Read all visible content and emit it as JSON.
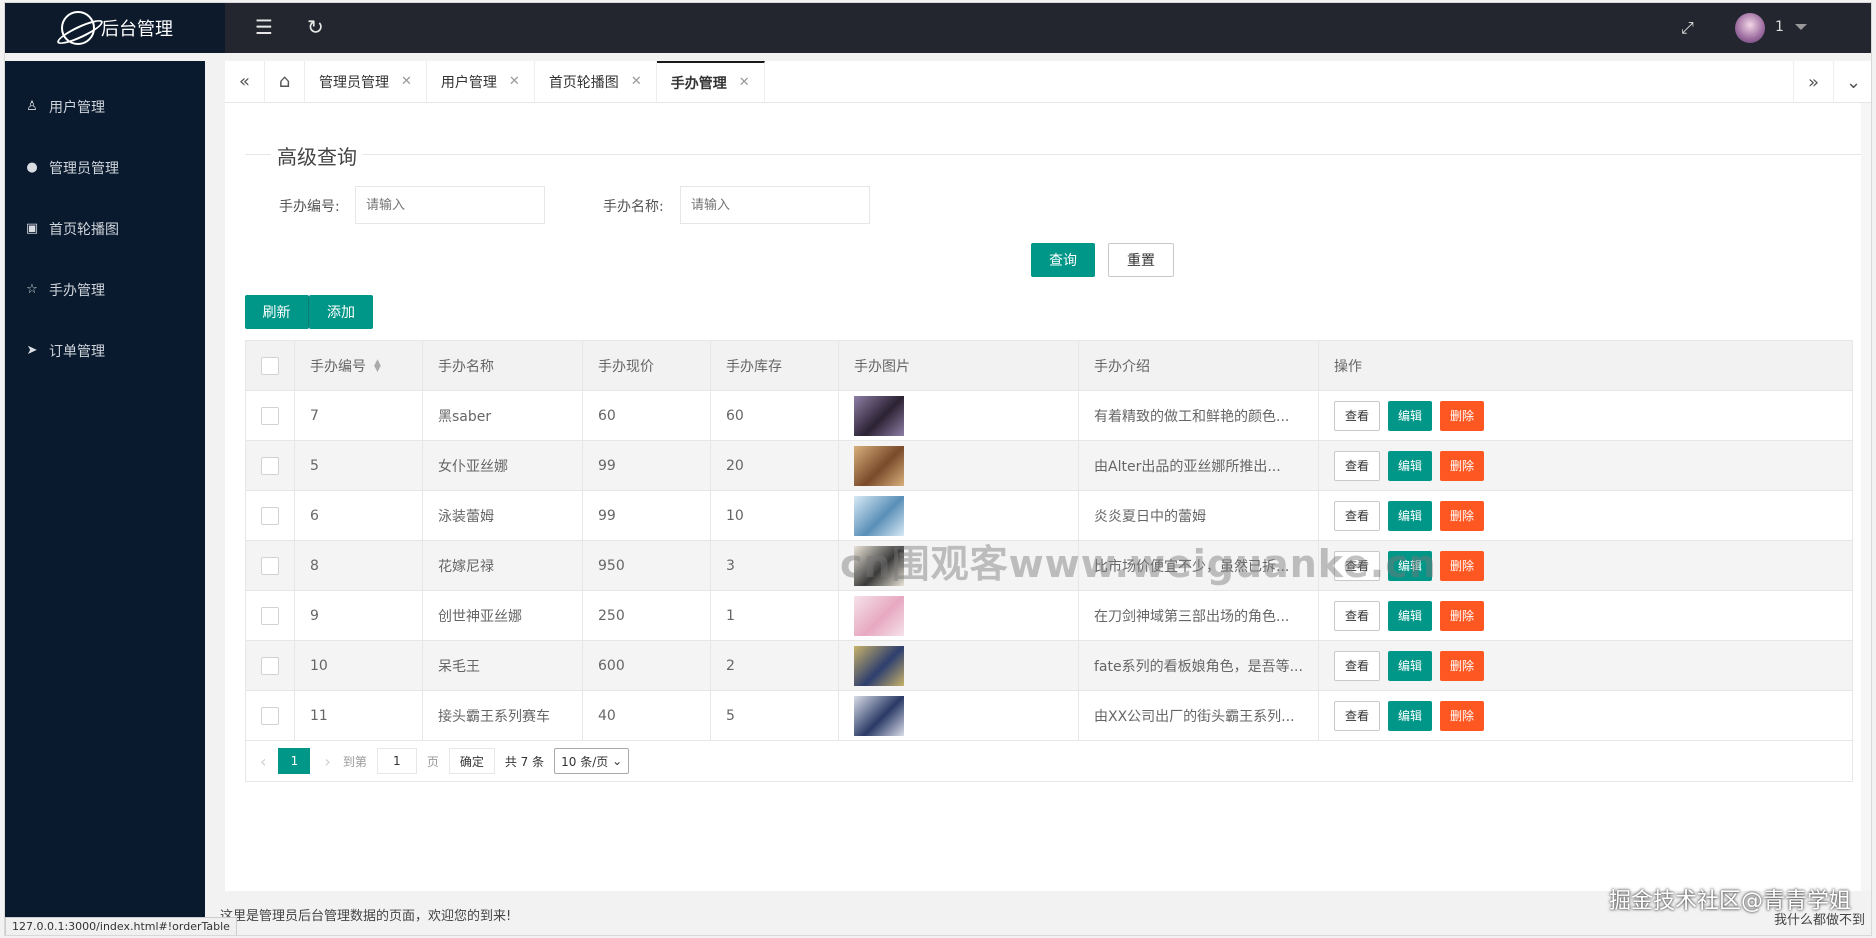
{
  "app": {
    "title": "后台管理"
  },
  "header": {
    "user_name": "1"
  },
  "sidebar": {
    "items": [
      {
        "label": "用户管理",
        "icon": "user-icon"
      },
      {
        "label": "管理员管理",
        "icon": "admin-icon"
      },
      {
        "label": "首页轮播图",
        "icon": "image-icon"
      },
      {
        "label": "手办管理",
        "icon": "star-icon"
      },
      {
        "label": "订单管理",
        "icon": "send-icon"
      }
    ]
  },
  "tabs": [
    {
      "label": "管理员管理"
    },
    {
      "label": "用户管理"
    },
    {
      "label": "首页轮播图"
    },
    {
      "label": "手办管理",
      "active": true
    }
  ],
  "search": {
    "title": "高级查询",
    "field1_label": "手办编号:",
    "field1_placeholder": "请输入",
    "field2_label": "手办名称:",
    "field2_placeholder": "请输入",
    "query_label": "查询",
    "reset_label": "重置"
  },
  "toolbar": {
    "refresh_label": "刷新",
    "add_label": "添加"
  },
  "table": {
    "columns": [
      "手办编号",
      "手办名称",
      "手办现价",
      "手办库存",
      "手办图片",
      "手办介绍",
      "操作"
    ],
    "rows": [
      {
        "id": "7",
        "name": "黑saber",
        "price": "60",
        "stock": "60",
        "intro": "有着精致的做工和鲜艳的颜色..."
      },
      {
        "id": "5",
        "name": "女仆亚丝娜",
        "price": "99",
        "stock": "20",
        "intro": "由Alter出品的亚丝娜所推出..."
      },
      {
        "id": "6",
        "name": "泳装蕾姆",
        "price": "99",
        "stock": "10",
        "intro": "炎炎夏日中的蕾姆"
      },
      {
        "id": "8",
        "name": "花嫁尼禄",
        "price": "950",
        "stock": "3",
        "intro": "比市场价便宜不少，虽然已拆..."
      },
      {
        "id": "9",
        "name": "创世神亚丝娜",
        "price": "250",
        "stock": "1",
        "intro": "在刀剑神域第三部出场的角色..."
      },
      {
        "id": "10",
        "name": "呆毛王",
        "price": "600",
        "stock": "2",
        "intro": "fate系列的看板娘角色，是吾等..."
      },
      {
        "id": "11",
        "name": "接头霸王系列赛车",
        "price": "40",
        "stock": "5",
        "intro": "由XX公司出厂的街头霸王系列..."
      }
    ],
    "actions": {
      "view": "查看",
      "edit": "编辑",
      "delete": "删除"
    }
  },
  "pager": {
    "current": "1",
    "goto_label": "到第",
    "page_value": "1",
    "page_unit": "页",
    "confirm_label": "确定",
    "total_label": "共 7 条",
    "page_size": "10 条/页"
  },
  "footer": {
    "text": "这里是管理员后台管理数据的页面，欢迎您的到来!",
    "right_text": "我什么都做不到"
  },
  "statusbar": {
    "url": "127.0.0.1:3000/index.html#!orderTable"
  },
  "watermark": {
    "text": "cn围观客www.weiguanke.cn",
    "corner": "掘金技术社区@青青学姐"
  },
  "colors": {
    "primary": "#009688",
    "danger": "#ff5722",
    "sidebar": "#0a1a2e",
    "header": "#23262e"
  }
}
